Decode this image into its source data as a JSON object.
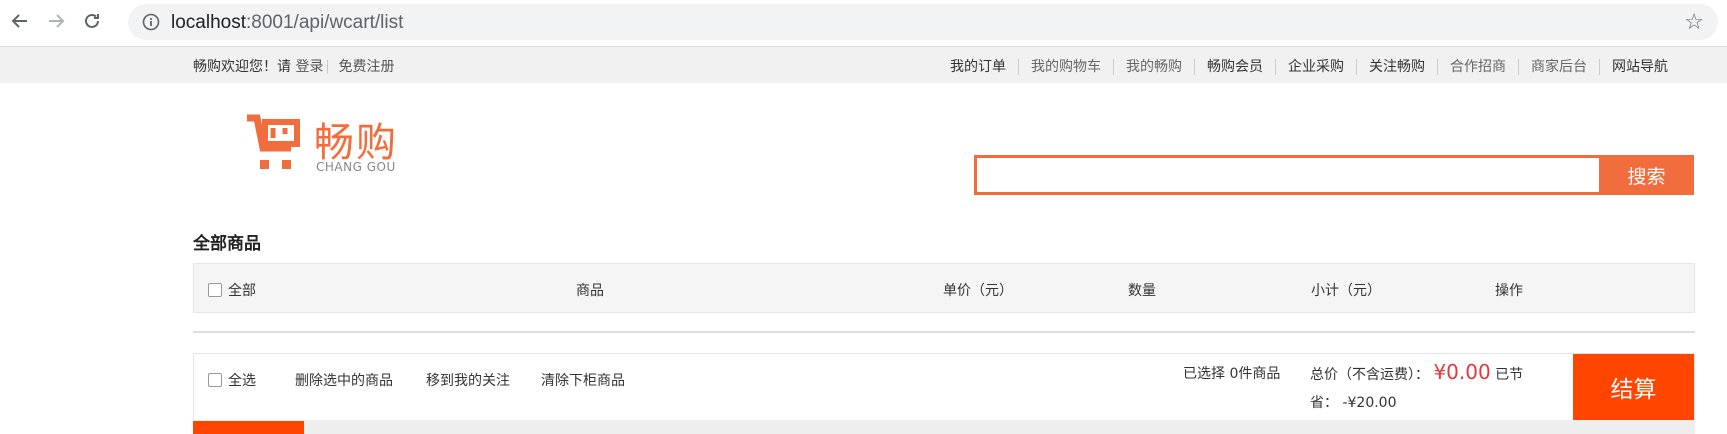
{
  "browser": {
    "url_host": "localhost",
    "url_rest": ":8001/api/wcart/list"
  },
  "shortcut": {
    "welcome": "畅购欢迎您！请",
    "login": "登录",
    "register": "免费注册",
    "links": [
      "我的订单",
      "我的购物车",
      "我的畅购",
      "畅购会员",
      "企业采购",
      "关注畅购",
      "合作招商",
      "商家后台",
      "网站导航"
    ]
  },
  "logo": {
    "cn": "畅购",
    "en": "CHANG GOU"
  },
  "search": {
    "placeholder": "",
    "button": "搜索"
  },
  "cart": {
    "title": "全部商品",
    "headers": {
      "all": "全部",
      "goods": "商品",
      "price": "单价（元）",
      "qty": "数量",
      "subtotal": "小计（元）",
      "ops": "操作"
    }
  },
  "footer": {
    "select_all": "全选",
    "delete_selected": "删除选中的商品",
    "move_to_follow": "移到我的关注",
    "clear_off_shelf": "清除下柜商品",
    "selected_info": "已选择 0件商品",
    "total_label": "总价（不含运费）：",
    "total_value": "¥0.00",
    "saved_label_a": "已节",
    "saved_label_b": "省：",
    "saved_value": "-¥20.00",
    "checkout": "结算"
  },
  "colors": {
    "brand": "#f26d3d",
    "checkout": "#ff4500",
    "price": "#e4393c"
  }
}
